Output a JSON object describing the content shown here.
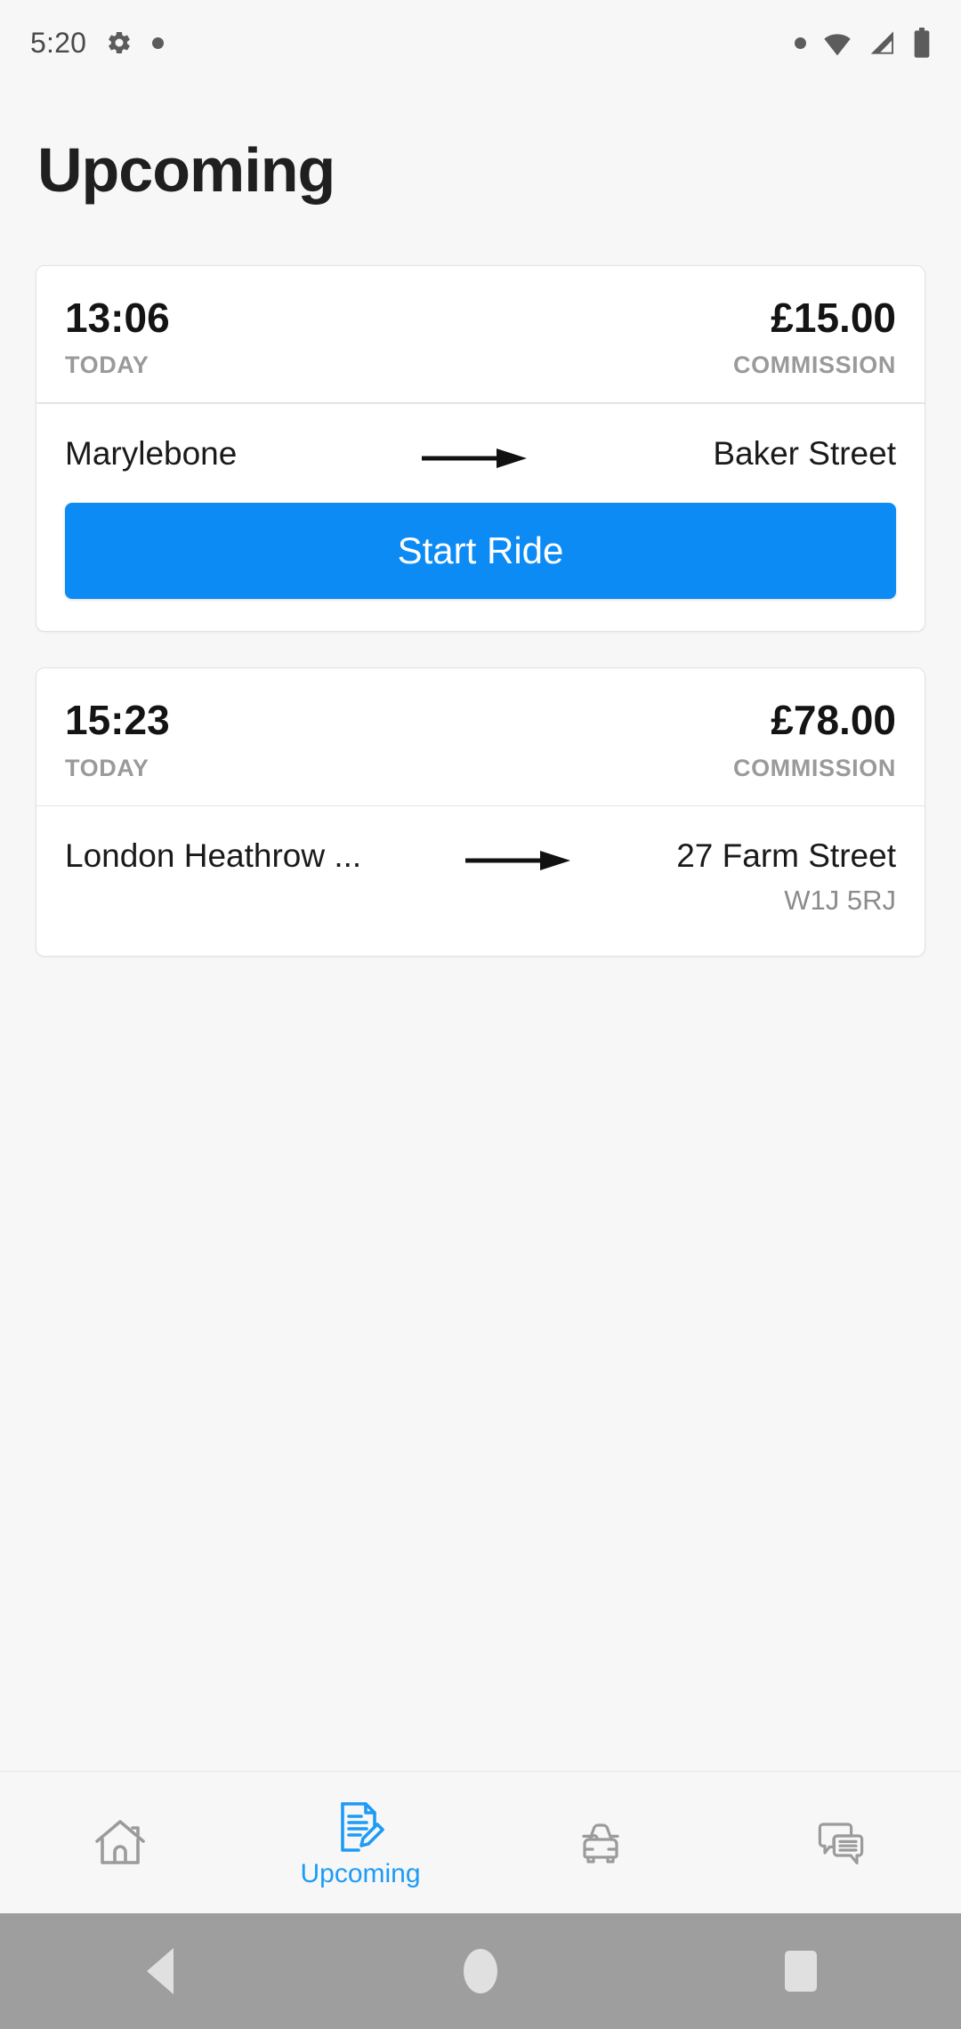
{
  "status_bar": {
    "time": "5:20",
    "left_icons": [
      "gear-icon",
      "dot-indicator-icon"
    ],
    "right_icons": [
      "dot-indicator-icon",
      "wifi-icon",
      "cellular-signal-icon",
      "battery-icon"
    ]
  },
  "header": {
    "title": "Upcoming"
  },
  "rides": [
    {
      "time": "13:06",
      "day_label": "TODAY",
      "amount": "£15.00",
      "amount_label": "COMMISSION",
      "from": "Marylebone",
      "from_postcode": "",
      "to": "Baker Street",
      "to_postcode": "",
      "action_label": "Start Ride",
      "has_action": true
    },
    {
      "time": "15:23",
      "day_label": "TODAY",
      "amount": "£78.00",
      "amount_label": "COMMISSION",
      "from": "London Heathrow ...",
      "from_postcode": "",
      "to": "27 Farm Street",
      "to_postcode": "W1J 5RJ",
      "action_label": "",
      "has_action": false
    }
  ],
  "bottom_nav": {
    "items": [
      {
        "icon": "home-icon",
        "label": "",
        "active": false
      },
      {
        "icon": "document-pencil-icon",
        "label": "Upcoming",
        "active": true
      },
      {
        "icon": "car-icon",
        "label": "",
        "active": false
      },
      {
        "icon": "chat-bubbles-icon",
        "label": "",
        "active": false
      }
    ]
  },
  "android_nav": {
    "back": "back-button",
    "home": "home-button",
    "recents": "recents-button"
  },
  "colors": {
    "accent": "#0d8bf5",
    "nav_active": "#1d9bf7",
    "background": "#f7f7f7",
    "card": "#ffffff",
    "muted_text": "#9a9a9a",
    "system_nav": "#9e9e9e"
  }
}
